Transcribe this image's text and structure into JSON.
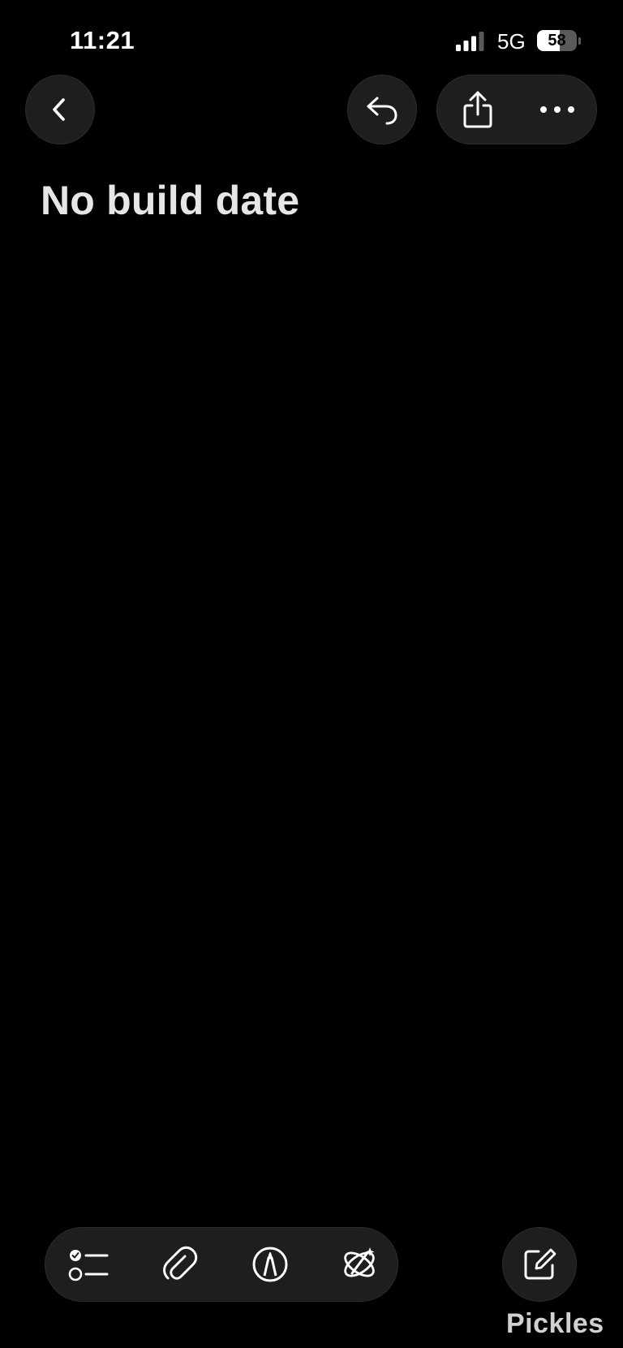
{
  "status_bar": {
    "time": "11:21",
    "network": "5G",
    "battery": "58",
    "battery_level": 0.58
  },
  "toolbar_top": {
    "back_icon": "chevron-left-icon",
    "undo_icon": "undo-arrow-icon",
    "share_icon": "share-icon",
    "more_icon": "ellipsis-icon"
  },
  "note": {
    "title": "No build date"
  },
  "toolbar_bottom": {
    "checklist_icon": "checklist-icon",
    "attachment_icon": "paperclip-icon",
    "markup_icon": "pen-markup-icon",
    "writing_tools_icon": "writing-tools-icon",
    "compose_icon": "compose-icon"
  },
  "watermark": "Pickles",
  "colors": {
    "background": "#000000",
    "button_fill": "#1e1e1e",
    "title_text": "#e6e6e6"
  }
}
